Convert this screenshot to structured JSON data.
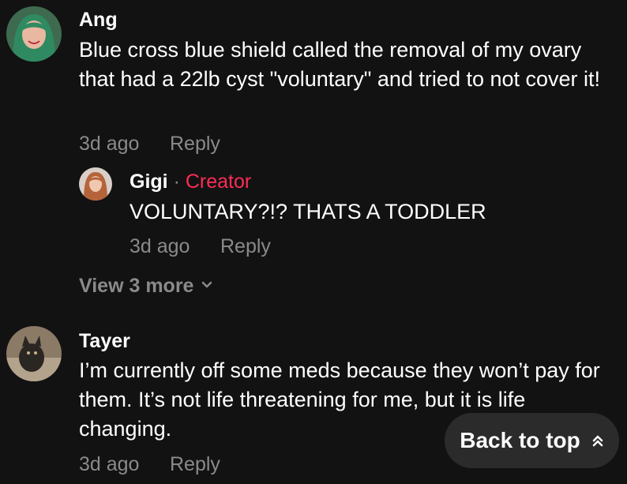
{
  "comments": [
    {
      "author": "Ang",
      "text": "Blue cross blue shield called the removal of my ovary that had a 22lb cyst \"voluntary\" and tried to not cover it!",
      "time": "3d ago",
      "reply_label": "Reply",
      "replies": [
        {
          "author": "Gigi",
          "separator": "·",
          "badge": "Creator",
          "text": "VOLUNTARY?!? THATS A TODDLER",
          "time": "3d ago",
          "reply_label": "Reply"
        }
      ],
      "view_more_label": "View 3 more"
    },
    {
      "author": "Tayer",
      "text": "I’m currently off some meds because they won’t pay for them. It’s not life threatening for me, but it is life changing.",
      "time": "3d ago",
      "reply_label": "Reply"
    }
  ],
  "back_to_top_label": "Back to top",
  "colors": {
    "background": "#121212",
    "creator_badge": "#fe2c55",
    "muted": "#8a8a8a",
    "pill": "#2b2b2b"
  },
  "icons": [
    "chevron-down-icon",
    "double-chevron-up-icon"
  ]
}
